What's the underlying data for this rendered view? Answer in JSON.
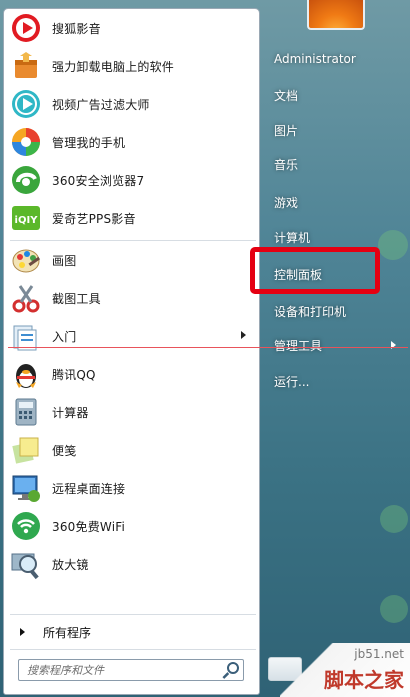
{
  "left_pane": {
    "programs": [
      {
        "label": "搜狐影音",
        "icon": "sohu-video-icon"
      },
      {
        "label": "强力卸载电脑上的软件",
        "icon": "uninstall-box-icon"
      },
      {
        "label": "视频广告过滤大师",
        "icon": "ad-filter-icon"
      },
      {
        "label": "管理我的手机",
        "icon": "phone-manager-icon"
      },
      {
        "label": "360安全浏览器7",
        "icon": "360-browser-icon"
      },
      {
        "label": "爱奇艺PPS影音",
        "icon": "iqiyi-pps-icon"
      },
      {
        "label": "画图",
        "icon": "paint-icon"
      },
      {
        "label": "截图工具",
        "icon": "snipping-tool-icon"
      },
      {
        "label": "入门",
        "icon": "getting-started-icon"
      },
      {
        "label": "腾讯QQ",
        "icon": "qq-penguin-icon"
      },
      {
        "label": "计算器",
        "icon": "calculator-icon"
      },
      {
        "label": "便笺",
        "icon": "sticky-notes-icon"
      },
      {
        "label": "远程桌面连接",
        "icon": "remote-desktop-icon"
      },
      {
        "label": "360免费WiFi",
        "icon": "wifi-icon"
      },
      {
        "label": "放大镜",
        "icon": "magnifier-icon"
      }
    ],
    "all_programs_label": "所有程序",
    "search": {
      "placeholder": "搜索程序和文件"
    }
  },
  "right_pane": {
    "items": [
      {
        "label": "Administrator"
      },
      {
        "label": "文档"
      },
      {
        "label": "图片"
      },
      {
        "label": "音乐"
      },
      {
        "label": "游戏"
      },
      {
        "label": "计算机"
      },
      {
        "label": "控制面板"
      },
      {
        "label": "设备和打印机"
      },
      {
        "label": "管理工具"
      },
      {
        "label": "运行..."
      }
    ]
  },
  "watermark": {
    "site": "jb51.net",
    "name": "脚本之家"
  },
  "colors": {
    "highlight": "#e50012",
    "line": "#e8535b",
    "left_bg": "#ffffff"
  }
}
